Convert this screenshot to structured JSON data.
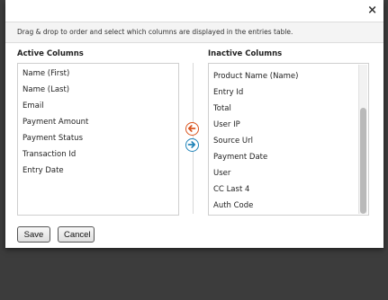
{
  "dialog": {
    "close_label": "×",
    "instructions": "Drag & drop to order and select which columns are displayed in the entries table."
  },
  "active": {
    "heading": "Active Columns",
    "items": [
      "Name (First)",
      "Name (Last)",
      "Email",
      "Payment Amount",
      "Payment Status",
      "Transaction Id",
      "Entry Date"
    ]
  },
  "inactive": {
    "heading": "Inactive Columns",
    "items": [
      "Product Name (Name)",
      "Entry Id",
      "Total",
      "User IP",
      "Source Url",
      "Payment Date",
      "User",
      "CC Last 4",
      "Auth Code"
    ]
  },
  "buttons": {
    "save": "Save",
    "cancel": "Cancel"
  },
  "icons": {
    "move_left": "arrow-left-icon",
    "move_right": "arrow-right-icon"
  },
  "colors": {
    "move_left": "#d9541e",
    "move_right": "#1f83b8"
  }
}
